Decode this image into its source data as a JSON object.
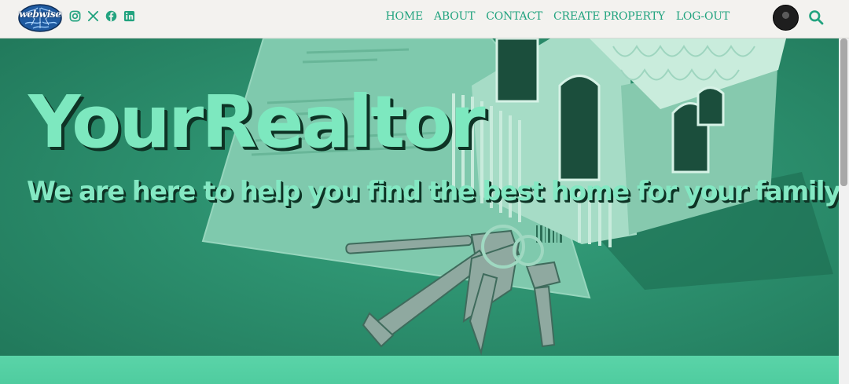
{
  "header": {
    "logo_text": "webwise",
    "socials": [
      {
        "icon": "instagram-icon"
      },
      {
        "icon": "x-twitter-icon"
      },
      {
        "icon": "facebook-icon"
      },
      {
        "icon": "linkedin-icon"
      }
    ],
    "nav": [
      {
        "label": "HOME"
      },
      {
        "label": "ABOUT"
      },
      {
        "label": "CONTACT"
      },
      {
        "label": "CREATE PROPERTY"
      },
      {
        "label": "LOG-OUT"
      }
    ],
    "search_icon": "search-icon"
  },
  "hero": {
    "title": "YourRealtor",
    "subtitle": "We are here to help you find the best home for your family."
  },
  "colors": {
    "accent": "#22a37f",
    "overlay": "#2f9876",
    "title": "#7de8bf",
    "band": "#5ad4a8"
  }
}
